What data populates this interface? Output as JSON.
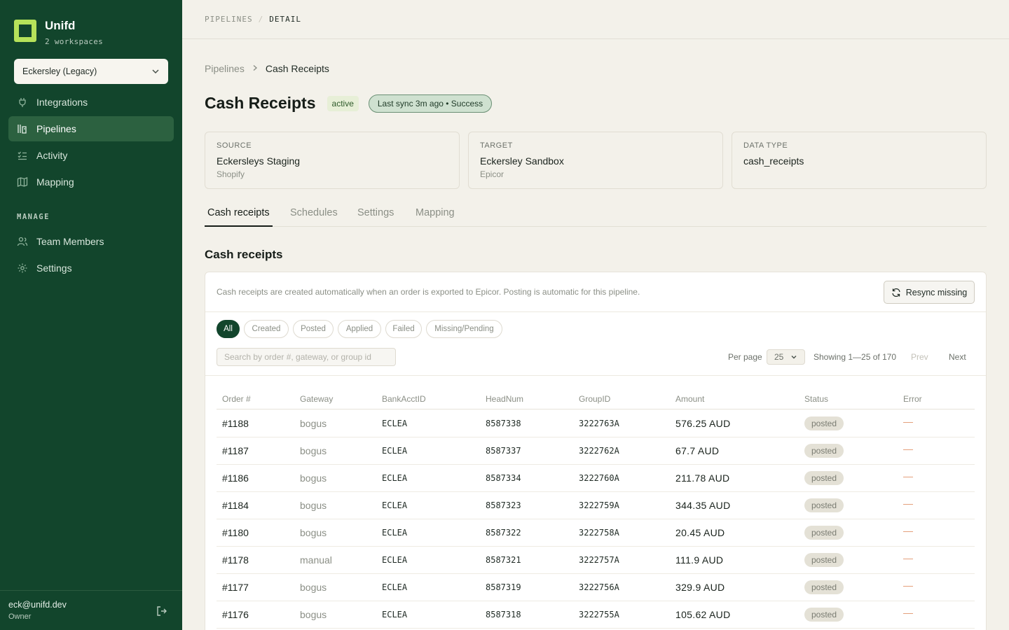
{
  "sidebar": {
    "brand_name": "Unifd",
    "brand_sub": "2 workspaces",
    "workspace": "Eckersley (Legacy)",
    "items": [
      {
        "label": "Integrations",
        "icon": "plug-icon"
      },
      {
        "label": "Pipelines",
        "icon": "pipelines-icon"
      },
      {
        "label": "Activity",
        "icon": "activity-icon"
      },
      {
        "label": "Mapping",
        "icon": "map-icon"
      }
    ],
    "manage_label": "MANAGE",
    "manage_items": [
      {
        "label": "Team Members",
        "icon": "users-icon"
      },
      {
        "label": "Settings",
        "icon": "gear-icon"
      }
    ],
    "user_email": "eck@unifd.dev",
    "user_role": "Owner"
  },
  "topbar": {
    "crumb_root": "PIPELINES",
    "crumb_sep": "/",
    "crumb_current": "DETAIL"
  },
  "breadcrumb": {
    "root": "Pipelines",
    "current": "Cash Receipts"
  },
  "page": {
    "title": "Cash Receipts",
    "status_badge": "active",
    "sync_badge": "Last sync 3m ago • Success"
  },
  "cards": [
    {
      "label": "SOURCE",
      "value": "Eckersleys Staging",
      "sub": "Shopify"
    },
    {
      "label": "TARGET",
      "value": "Eckersley Sandbox",
      "sub": "Epicor"
    },
    {
      "label": "DATA TYPE",
      "value": "cash_receipts",
      "sub": ""
    }
  ],
  "tabs": [
    "Cash receipts",
    "Schedules",
    "Settings",
    "Mapping"
  ],
  "section_title": "Cash receipts",
  "panel": {
    "description": "Cash receipts are created automatically when an order is exported to Epicor. Posting is automatic for this pipeline.",
    "resync_label": "Resync missing",
    "filters": [
      "All",
      "Created",
      "Posted",
      "Applied",
      "Failed",
      "Missing/Pending"
    ],
    "search_placeholder": "Search by order #, gateway, or group id",
    "per_page_label": "Per page",
    "per_page_value": "25",
    "showing": "Showing 1—25 of 170",
    "prev": "Prev",
    "next": "Next"
  },
  "table": {
    "columns": [
      "Order #",
      "Gateway",
      "BankAcctID",
      "HeadNum",
      "GroupID",
      "Amount",
      "Status",
      "Error"
    ],
    "rows": [
      {
        "order": "#1188",
        "gateway": "bogus",
        "bank": "ECLEA",
        "head": "8587338",
        "group": "3222763A",
        "amount": "576.25 AUD",
        "status": "posted",
        "error": "—"
      },
      {
        "order": "#1187",
        "gateway": "bogus",
        "bank": "ECLEA",
        "head": "8587337",
        "group": "3222762A",
        "amount": "67.7 AUD",
        "status": "posted",
        "error": "—"
      },
      {
        "order": "#1186",
        "gateway": "bogus",
        "bank": "ECLEA",
        "head": "8587334",
        "group": "3222760A",
        "amount": "211.78 AUD",
        "status": "posted",
        "error": "—"
      },
      {
        "order": "#1184",
        "gateway": "bogus",
        "bank": "ECLEA",
        "head": "8587323",
        "group": "3222759A",
        "amount": "344.35 AUD",
        "status": "posted",
        "error": "—"
      },
      {
        "order": "#1180",
        "gateway": "bogus",
        "bank": "ECLEA",
        "head": "8587322",
        "group": "3222758A",
        "amount": "20.45 AUD",
        "status": "posted",
        "error": "—"
      },
      {
        "order": "#1178",
        "gateway": "manual",
        "bank": "ECLEA",
        "head": "8587321",
        "group": "3222757A",
        "amount": "111.9 AUD",
        "status": "posted",
        "error": "—"
      },
      {
        "order": "#1177",
        "gateway": "bogus",
        "bank": "ECLEA",
        "head": "8587319",
        "group": "3222756A",
        "amount": "329.9 AUD",
        "status": "posted",
        "error": "—"
      },
      {
        "order": "#1176",
        "gateway": "bogus",
        "bank": "ECLEA",
        "head": "8587318",
        "group": "3222755A",
        "amount": "105.62 AUD",
        "status": "posted",
        "error": "—"
      }
    ]
  },
  "colors": {
    "sidebar_bg": "#12452c",
    "active_nav_bg": "#2c6140",
    "logo_accent": "#b6e25a",
    "page_bg": "#f3f1ea",
    "error_dash": "#e39a73"
  }
}
